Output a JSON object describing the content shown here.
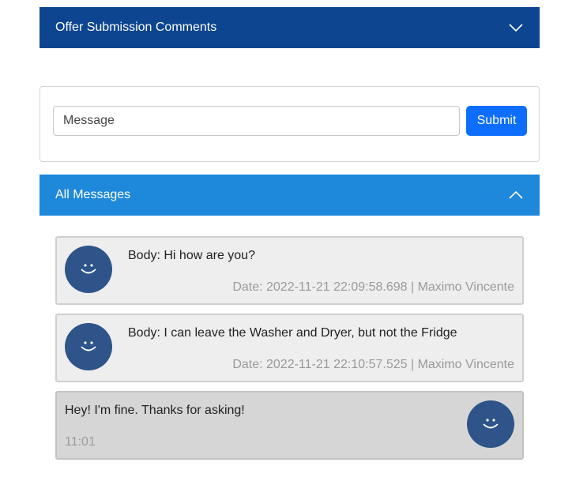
{
  "offer_section": {
    "title": "Offer Submission Comments",
    "toggle_icon": "chevron-down-icon"
  },
  "composer": {
    "placeholder": "Message",
    "value": "",
    "submit_label": "Submit",
    "submit_color": "#0d6efd"
  },
  "messages_section": {
    "title": "All Messages",
    "toggle_icon": "chevron-up-icon"
  },
  "messages": [
    {
      "body": "Body: Hi how are you?",
      "meta": "Date: 2022-11-21 22:09:58.698 | Maximo Vincente",
      "avatar_icon": "smiley-icon"
    },
    {
      "body": "Body: I can leave the Washer and Dryer, but not the Fridge",
      "meta": "Date: 2022-11-21 22:10:57.525 | Maximo Vincente",
      "avatar_icon": "smiley-icon"
    },
    {
      "body": "Hey! I'm fine. Thanks for asking!",
      "meta": "11:01",
      "avatar_icon": "smiley-icon"
    }
  ],
  "colors": {
    "offer_header_bg": "#0d4591",
    "messages_header_bg": "#1e88db",
    "avatar_bg": "#2e5489"
  }
}
